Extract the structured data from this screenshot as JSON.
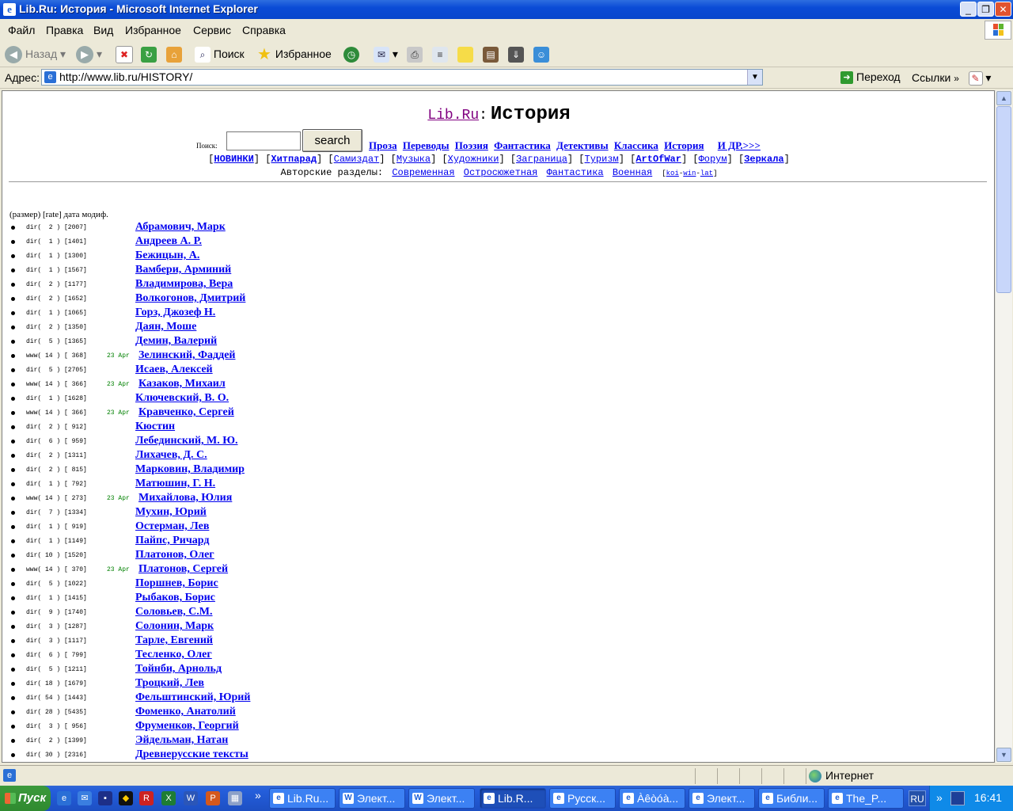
{
  "window": {
    "title": "Lib.Ru: История - Microsoft Internet Explorer"
  },
  "menu": [
    "Файл",
    "Правка",
    "Вид",
    "Избранное",
    "Сервис",
    "Справка"
  ],
  "toolbar": {
    "back": "Назад",
    "search": "Поиск",
    "favorites": "Избранное"
  },
  "address": {
    "label": "Адрес:",
    "url": "http://www.lib.ru/HISTORY/",
    "go": "Переход",
    "links": "Ссылки"
  },
  "page": {
    "site": "Lib.Ru",
    "colon": ":",
    "title": "История",
    "search_label": "Поиск:",
    "search_button": "search",
    "nav": [
      "Проза",
      "Переводы",
      "Поэзия",
      "Фантастика",
      "Детективы",
      "Классика",
      "История"
    ],
    "nav_more": "И ДР.>>>",
    "nav2": [
      {
        "label": "НОВИНКИ",
        "bold": true
      },
      {
        "label": "Хитпарад",
        "bold": true
      },
      {
        "label": "Самиздат",
        "bold": false
      },
      {
        "label": "Музыка",
        "bold": false
      },
      {
        "label": "Художники",
        "bold": false
      },
      {
        "label": "Заграница",
        "bold": false
      },
      {
        "label": "Туризм",
        "bold": false
      },
      {
        "label": "ArtOfWar",
        "bold": true
      },
      {
        "label": "Форум",
        "bold": false
      },
      {
        "label": "Зеркала",
        "bold": true
      }
    ],
    "author_sections_label": "Авторские разделы:",
    "author_sections": [
      "Современная",
      "Остросюжетная",
      "Фантастика",
      "Военная"
    ],
    "encodings": [
      "koi",
      "win",
      "lat"
    ],
    "column_header": "(размер) [rate] дата модиф.",
    "authors": [
      {
        "meta": "dir(  2 ) [2007]",
        "date": "",
        "name": "Абрамович, Марк"
      },
      {
        "meta": "dir(  1 ) [1401]",
        "date": "",
        "name": "Андреев А. Р."
      },
      {
        "meta": "dir(  1 ) [1300]",
        "date": "",
        "name": "Бежицын, А."
      },
      {
        "meta": "dir(  1 ) [1567]",
        "date": "",
        "name": "Вамбери, Арминий"
      },
      {
        "meta": "dir(  2 ) [1177]",
        "date": "",
        "name": "Владимирова, Вера"
      },
      {
        "meta": "dir(  2 ) [1652]",
        "date": "",
        "name": "Волкогонов, Дмитрий"
      },
      {
        "meta": "dir(  1 ) [1065]",
        "date": "",
        "name": "Горз, Джозеф Н."
      },
      {
        "meta": "dir(  2 ) [1350]",
        "date": "",
        "name": "Даян, Моше"
      },
      {
        "meta": "dir(  5 ) [1365]",
        "date": "",
        "name": "Демин, Валерий"
      },
      {
        "meta": "www( 14 ) [ 368]",
        "date": "23 Apr",
        "name": "Зелинский, Фаддей"
      },
      {
        "meta": "dir(  5 ) [2705]",
        "date": "",
        "name": "Исаев, Алексей"
      },
      {
        "meta": "www( 14 ) [ 366]",
        "date": "23 Apr",
        "name": "Казаков, Михаил"
      },
      {
        "meta": "dir(  1 ) [1628]",
        "date": "",
        "name": "Ключевский, В. О."
      },
      {
        "meta": "www( 14 ) [ 366]",
        "date": "23 Apr",
        "name": "Кравченко, Сергей"
      },
      {
        "meta": "dir(  2 ) [ 912]",
        "date": "",
        "name": "Кюстин"
      },
      {
        "meta": "dir(  6 ) [ 959]",
        "date": "",
        "name": "Лебединский, М. Ю."
      },
      {
        "meta": "dir(  2 ) [1311]",
        "date": "",
        "name": "Лихачев, Д. С."
      },
      {
        "meta": "dir(  2 ) [ 815]",
        "date": "",
        "name": "Марковин, Владимир"
      },
      {
        "meta": "dir(  1 ) [ 792]",
        "date": "",
        "name": "Матюшин, Г. Н."
      },
      {
        "meta": "www( 14 ) [ 273]",
        "date": "23 Apr",
        "name": "Михайлова, Юлия"
      },
      {
        "meta": "dir(  7 ) [1334]",
        "date": "",
        "name": "Мухин, Юрий"
      },
      {
        "meta": "dir(  1 ) [ 919]",
        "date": "",
        "name": "Остерман, Лев"
      },
      {
        "meta": "dir(  1 ) [1149]",
        "date": "",
        "name": "Пайпс, Ричард"
      },
      {
        "meta": "dir( 10 ) [1520]",
        "date": "",
        "name": "Платонов, Олег"
      },
      {
        "meta": "www( 14 ) [ 370]",
        "date": "23 Apr",
        "name": "Платонов, Сергей"
      },
      {
        "meta": "dir(  5 ) [1022]",
        "date": "",
        "name": "Поршнев, Борис"
      },
      {
        "meta": "dir(  1 ) [1415]",
        "date": "",
        "name": "Рыбаков, Борис"
      },
      {
        "meta": "dir(  9 ) [1740]",
        "date": "",
        "name": "Соловьев, С.М."
      },
      {
        "meta": "dir(  3 ) [1287]",
        "date": "",
        "name": "Солонин, Марк"
      },
      {
        "meta": "dir(  3 ) [1117]",
        "date": "",
        "name": "Тарле, Евгений"
      },
      {
        "meta": "dir(  6 ) [ 799]",
        "date": "",
        "name": "Тесленко, Олег"
      },
      {
        "meta": "dir(  5 ) [1211]",
        "date": "",
        "name": "Тойнби, Арнольд"
      },
      {
        "meta": "dir( 18 ) [1679]",
        "date": "",
        "name": "Троцкий, Лев"
      },
      {
        "meta": "dir( 54 ) [1443]",
        "date": "",
        "name": "Фельштинский, Юрий"
      },
      {
        "meta": "dir( 28 ) [5435]",
        "date": "",
        "name": "Фоменко, Анатолий"
      },
      {
        "meta": "dir(  3 ) [ 956]",
        "date": "",
        "name": "Фруменков, Георгий"
      },
      {
        "meta": "dir(  2 ) [1399]",
        "date": "",
        "name": "Эйдельман, Натан"
      },
      {
        "meta": "dir( 30 ) [2316]",
        "date": "",
        "name": "Древнерусские тексты"
      }
    ]
  },
  "status": {
    "zone": "Интернет"
  },
  "taskbar": {
    "start": "Пуск",
    "tasks": [
      {
        "label": "Lib.Ru...",
        "active": false
      },
      {
        "label": "Элект...",
        "active": false
      },
      {
        "label": "Элект...",
        "active": false
      },
      {
        "label": "Lib.R...",
        "active": true
      },
      {
        "label": "Русск...",
        "active": false
      },
      {
        "label": "Àêòóà...",
        "active": false
      },
      {
        "label": "Элект...",
        "active": false
      },
      {
        "label": "Библи...",
        "active": false
      },
      {
        "label": "The_P...",
        "active": false
      }
    ],
    "lang": "RU",
    "clock": "16:41",
    "chevron": "»"
  }
}
